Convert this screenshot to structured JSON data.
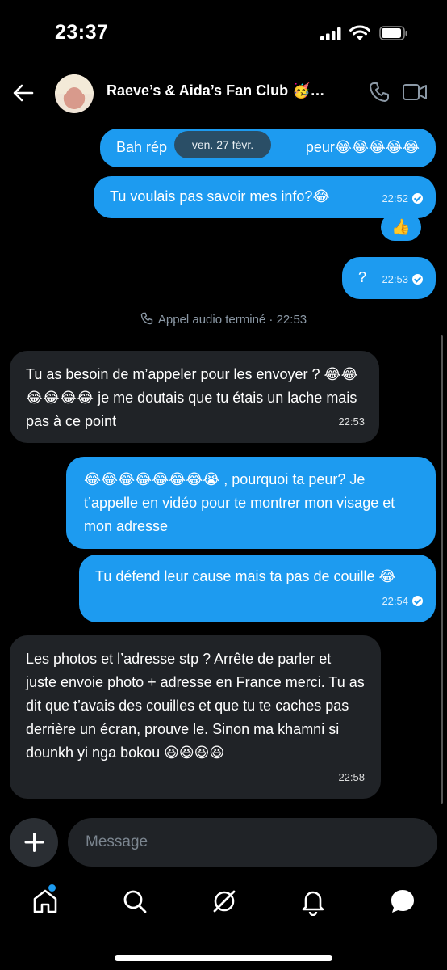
{
  "status_bar": {
    "time": "23:37"
  },
  "header": {
    "title": "Raeve’s & Aida’s Fan Club 🥳…"
  },
  "date_pill": "ven. 27 févr.",
  "messages": [
    {
      "text": "Bah rép",
      "text_tail": "peur😂😂😂😂😂"
    },
    {
      "text": "Tu voulais pas savoir mes info?😂",
      "time": "22:52"
    },
    {
      "reaction": "👍"
    },
    {
      "text": "?",
      "time": "22:53"
    },
    {
      "text": "Tu as besoin de m’appeler pour les envoyer ? 😂😂😂😂😂😂 je me doutais que tu étais un lache mais pas à ce point",
      "time": "22:53"
    },
    {
      "text": "😂😂😂😂😂😂😂😭 , pourquoi ta peur? Je t’appelle en vidéo pour te montrer mon visage et mon adresse"
    },
    {
      "text": "Tu défend leur cause mais ta pas de couille 😂",
      "time": "22:54"
    },
    {
      "text": "Les photos et l’adresse stp ? Arrête de parler et juste envoie photo + adresse en France merci. Tu as dit que t’avais des couilles et que tu te caches pas derrière un écran, prouve le. Sinon ma khamni si dounkh yi nga bokou 😆😆😆😆",
      "time": "22:58"
    }
  ],
  "system_event": {
    "text": "Appel audio terminé · 22:53"
  },
  "composer": {
    "placeholder": "Message"
  },
  "tabs": [
    "home-icon",
    "search-icon",
    "grok-icon",
    "notifications-icon",
    "messages-icon"
  ],
  "colors": {
    "accent": "#1d9bf0",
    "received_bubble": "#202327",
    "background": "#000000"
  }
}
